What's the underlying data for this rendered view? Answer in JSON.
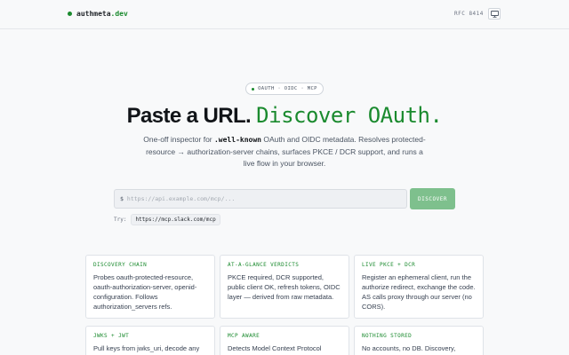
{
  "header": {
    "brand_name": "authmeta",
    "brand_tld": ".dev",
    "rfc_label": "RFC 8414",
    "theme_icon": "monitor-icon"
  },
  "hero": {
    "pill": "OAUTH · OIDC · MCP",
    "headline_plain": "Paste a URL.",
    "headline_accent": "Discover OAuth.",
    "subtitle_1": "One-off inspector for ",
    "subtitle_code": ".well-known",
    "subtitle_2": " OAuth and OIDC metadata. Resolves protected-resource → authorization-server chains, surfaces PKCE / DCR support, and runs a live flow in your browser."
  },
  "search": {
    "prompt": "$",
    "placeholder": "https://api.example.com/mcp/...",
    "value": "",
    "button_label": "DISCOVER",
    "try_label": "Try:",
    "try_example": "https://mcp.slack.com/mcp"
  },
  "cards": [
    {
      "title": "DISCOVERY CHAIN",
      "desc": "Probes oauth-protected-resource, oauth-authorization-server, openid-configuration. Follows authorization_servers refs."
    },
    {
      "title": "AT-A-GLANCE VERDICTS",
      "desc": "PKCE required, DCR supported, public client OK, refresh tokens, OIDC layer — derived from raw metadata."
    },
    {
      "title": "LIVE PKCE + DCR",
      "desc": "Register an ephemeral client, run the authorize redirect, exchange the code. AS calls proxy through our server (no CORS)."
    },
    {
      "title": "JWKS + JWT",
      "desc": "Pull keys from jwks_uri, decode any"
    },
    {
      "title": "MCP AWARE",
      "desc": "Detects Model Context Protocol"
    },
    {
      "title": "NOTHING STORED",
      "desc": "No accounts, no DB. Discovery,"
    }
  ],
  "colors": {
    "accent": "#1a8a2e",
    "button": "#7ec08d",
    "background": "#f8f9fa"
  }
}
